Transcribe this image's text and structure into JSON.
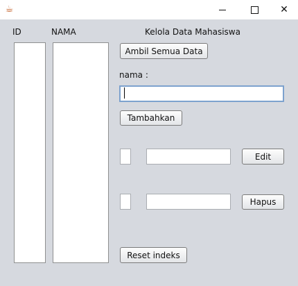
{
  "window": {
    "app_icon": "java-icon",
    "controls": [
      "minimize-icon",
      "maximize-icon",
      "close-icon"
    ],
    "close_glyph": "✕"
  },
  "lists": {
    "id_header": "ID",
    "nama_header": "NAMA",
    "id_items": [],
    "nama_items": []
  },
  "form": {
    "title": "Kelola Data Mahasiswa",
    "ambil_button": "Ambil Semua Data",
    "nama_label": "nama :",
    "nama_value": "",
    "tambahkan_button": "Tambahkan",
    "edit_id_value": "",
    "edit_nama_value": "",
    "edit_button": "Edit",
    "hapus_id_value": "",
    "hapus_nama_value": "",
    "hapus_button": "Hapus",
    "reset_button": "Reset indeks"
  }
}
